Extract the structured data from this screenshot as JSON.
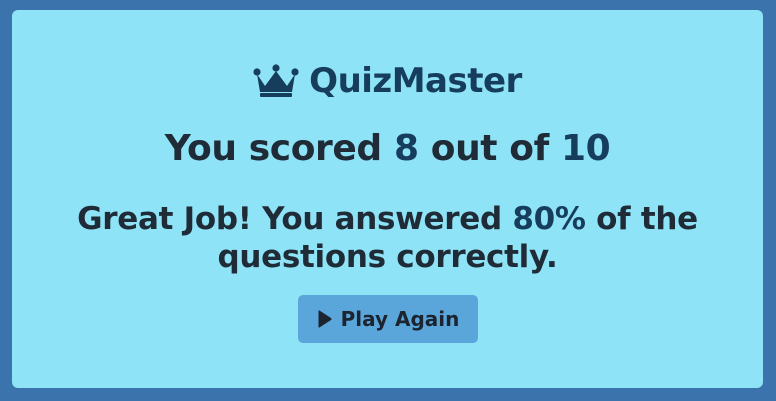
{
  "app": {
    "title": "QuizMaster",
    "icon": "crown-icon"
  },
  "score": {
    "prefix": "You scored",
    "correct": "8",
    "middle": "out of",
    "total": "10"
  },
  "message": {
    "prefix": "Great Job! You answered",
    "percent": "80%",
    "suffix": "of the questions correctly."
  },
  "actions": {
    "play_again_label": "Play Again",
    "play_again_icon": "play-icon"
  },
  "colors": {
    "page_background": "#3b73ad",
    "card_background": "#8fe3f7",
    "accent_text": "#163d5c",
    "button_background": "#5aa6db"
  }
}
